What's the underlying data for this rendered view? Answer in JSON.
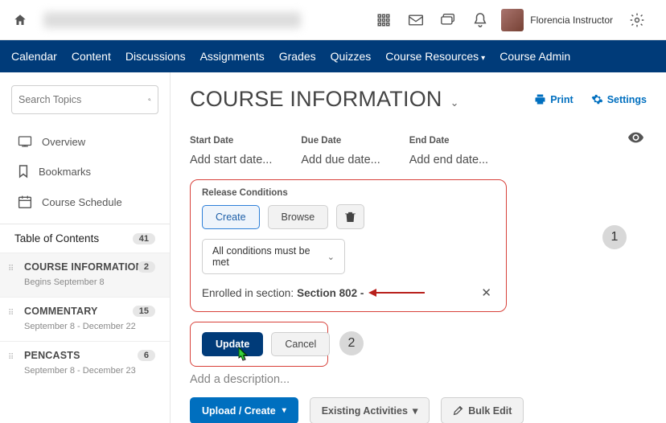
{
  "topbar": {
    "user_name": "Florencia Instructor"
  },
  "navbar": {
    "items": [
      "Calendar",
      "Content",
      "Discussions",
      "Assignments",
      "Grades",
      "Quizzes",
      "Course Resources",
      "Course Admin"
    ]
  },
  "sidebar": {
    "search_placeholder": "Search Topics",
    "links": {
      "overview": "Overview",
      "bookmarks": "Bookmarks",
      "schedule": "Course Schedule"
    },
    "toc_label": "Table of Contents",
    "toc_badge": "41",
    "modules": [
      {
        "title": "COURSE INFORMATION",
        "subtitle": "Begins September 8",
        "badge": "2",
        "active": true
      },
      {
        "title": "COMMENTARY",
        "subtitle": "September 8 - December 22",
        "badge": "15",
        "active": false
      },
      {
        "title": "PENCASTS",
        "subtitle": "September 8 - December 23",
        "badge": "6",
        "active": false
      }
    ]
  },
  "main": {
    "title": "COURSE INFORMATION",
    "print_label": "Print",
    "settings_label": "Settings",
    "dates": {
      "start_label": "Start Date",
      "start_val": "Add start date...",
      "due_label": "Due Date",
      "due_val": "Add due date...",
      "end_label": "End Date",
      "end_val": "Add end date..."
    },
    "release": {
      "heading": "Release Conditions",
      "create": "Create",
      "browse": "Browse",
      "select_label": "All conditions must be met",
      "cond_prefix": "Enrolled in section:",
      "cond_bold": "Section 802 -"
    },
    "annot": {
      "one": "1",
      "two": "2"
    },
    "update_btn": "Update",
    "cancel_btn": "Cancel",
    "desc_placeholder": "Add a description...",
    "actions": {
      "upload": "Upload / Create",
      "existing": "Existing Activities",
      "bulk": "Bulk Edit"
    }
  }
}
